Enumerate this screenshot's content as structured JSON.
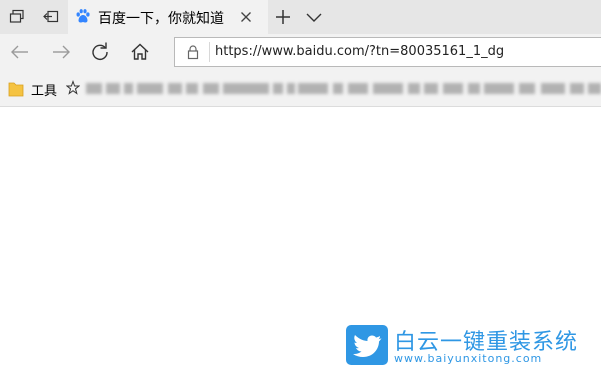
{
  "tab": {
    "title": "百度一下，你就知道"
  },
  "address_bar": {
    "url": "https://www.baidu.com/?tn=80035161_1_dg"
  },
  "favorites_bar": {
    "folder_label": "工具"
  },
  "watermark": {
    "title": "白云一键重装系统",
    "subtitle": "www.baiyunxitong.com"
  },
  "colors": {
    "brand_blue": "#2f97e4",
    "baidu_blue": "#3385ff",
    "folder_yellow": "#f5c342"
  },
  "icons": [
    "tab-actions-icon",
    "set-tabs-aside-icon",
    "baidu-paw-icon",
    "close-icon",
    "plus-icon",
    "chevron-down-icon",
    "back-arrow-icon",
    "forward-arrow-icon",
    "refresh-icon",
    "home-icon",
    "lock-icon",
    "folder-icon",
    "star-icon",
    "bird-logo-icon"
  ]
}
